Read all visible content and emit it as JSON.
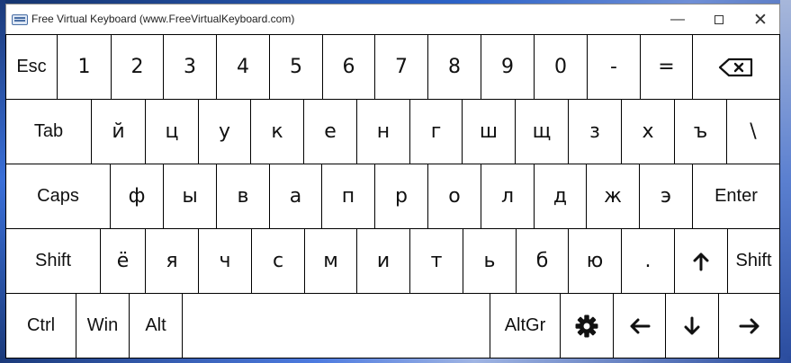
{
  "window": {
    "title": "Free Virtual Keyboard (www.FreeVirtualKeyboard.com)"
  },
  "rows": [
    {
      "keys": [
        {
          "label": "Esc",
          "name": "key-esc"
        },
        {
          "label": "1",
          "name": "key-1"
        },
        {
          "label": "2",
          "name": "key-2"
        },
        {
          "label": "3",
          "name": "key-3"
        },
        {
          "label": "4",
          "name": "key-4"
        },
        {
          "label": "5",
          "name": "key-5"
        },
        {
          "label": "6",
          "name": "key-6"
        },
        {
          "label": "7",
          "name": "key-7"
        },
        {
          "label": "8",
          "name": "key-8"
        },
        {
          "label": "9",
          "name": "key-9"
        },
        {
          "label": "0",
          "name": "key-0"
        },
        {
          "label": "-",
          "name": "key-minus"
        },
        {
          "label": "=",
          "name": "key-equals"
        },
        {
          "label": "",
          "name": "key-backspace",
          "icon": "backspace-icon"
        }
      ]
    },
    {
      "keys": [
        {
          "label": "Tab",
          "name": "key-tab"
        },
        {
          "label": "й",
          "name": "key-й"
        },
        {
          "label": "ц",
          "name": "key-ц"
        },
        {
          "label": "у",
          "name": "key-у"
        },
        {
          "label": "к",
          "name": "key-к"
        },
        {
          "label": "е",
          "name": "key-е"
        },
        {
          "label": "н",
          "name": "key-н"
        },
        {
          "label": "г",
          "name": "key-г"
        },
        {
          "label": "ш",
          "name": "key-ш"
        },
        {
          "label": "щ",
          "name": "key-щ"
        },
        {
          "label": "з",
          "name": "key-з"
        },
        {
          "label": "х",
          "name": "key-х"
        },
        {
          "label": "ъ",
          "name": "key-ъ"
        },
        {
          "label": "\\",
          "name": "key-backslash"
        }
      ]
    },
    {
      "keys": [
        {
          "label": "Caps",
          "name": "key-caps"
        },
        {
          "label": "ф",
          "name": "key-ф"
        },
        {
          "label": "ы",
          "name": "key-ы"
        },
        {
          "label": "в",
          "name": "key-в"
        },
        {
          "label": "а",
          "name": "key-а"
        },
        {
          "label": "п",
          "name": "key-п"
        },
        {
          "label": "р",
          "name": "key-р"
        },
        {
          "label": "о",
          "name": "key-о"
        },
        {
          "label": "л",
          "name": "key-л"
        },
        {
          "label": "д",
          "name": "key-д"
        },
        {
          "label": "ж",
          "name": "key-ж"
        },
        {
          "label": "э",
          "name": "key-э"
        },
        {
          "label": "Enter",
          "name": "key-enter"
        }
      ]
    },
    {
      "keys": [
        {
          "label": "Shift",
          "name": "key-shift-left"
        },
        {
          "label": "ё",
          "name": "key-ё"
        },
        {
          "label": "я",
          "name": "key-я"
        },
        {
          "label": "ч",
          "name": "key-ч"
        },
        {
          "label": "с",
          "name": "key-с"
        },
        {
          "label": "м",
          "name": "key-м"
        },
        {
          "label": "и",
          "name": "key-и"
        },
        {
          "label": "т",
          "name": "key-т"
        },
        {
          "label": "ь",
          "name": "key-ь"
        },
        {
          "label": "б",
          "name": "key-б"
        },
        {
          "label": "ю",
          "name": "key-ю"
        },
        {
          "label": ".",
          "name": "key-period"
        },
        {
          "label": "",
          "name": "key-arrow-up",
          "icon": "arrow-up-icon"
        },
        {
          "label": "Shift",
          "name": "key-shift-right"
        }
      ]
    },
    {
      "keys": [
        {
          "label": "Ctrl",
          "name": "key-ctrl"
        },
        {
          "label": "Win",
          "name": "key-win"
        },
        {
          "label": "Alt",
          "name": "key-alt"
        },
        {
          "label": "",
          "name": "key-space"
        },
        {
          "label": "AltGr",
          "name": "key-altgr"
        },
        {
          "label": "",
          "name": "key-settings",
          "icon": "gear-icon"
        },
        {
          "label": "",
          "name": "key-arrow-left",
          "icon": "arrow-left-icon"
        },
        {
          "label": "",
          "name": "key-arrow-down",
          "icon": "arrow-down-icon"
        },
        {
          "label": "",
          "name": "key-arrow-right",
          "icon": "arrow-right-icon"
        }
      ]
    }
  ]
}
